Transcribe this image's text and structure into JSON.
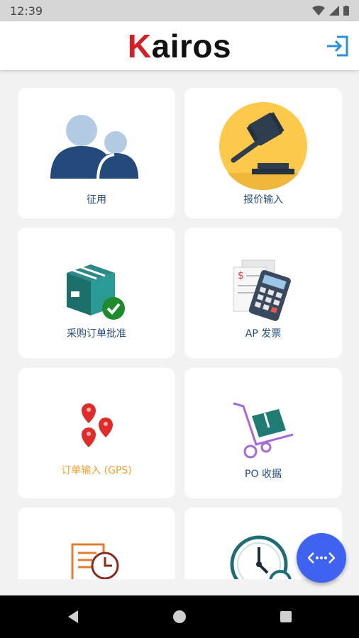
{
  "status": {
    "time": "12:39"
  },
  "header": {
    "logo_first": "K",
    "logo_rest": "airos"
  },
  "tiles": [
    {
      "label": "征用",
      "icon": "users-icon",
      "label_color": "#234a7a"
    },
    {
      "label": "报价输入",
      "icon": "gavel-icon",
      "label_color": "#234a7a"
    },
    {
      "label": "采购订单批准",
      "icon": "package-check-icon",
      "label_color": "#1b6e6a"
    },
    {
      "label": "AP 发票",
      "icon": "invoice-calculator-icon",
      "label_color": "#234a7a"
    },
    {
      "label": "订单输入 (GPS)",
      "icon": "map-pins-icon",
      "label_color": "#f0a030"
    },
    {
      "label": "PO 收据",
      "icon": "hand-truck-icon",
      "label_color": "#234a7a"
    },
    {
      "label": "",
      "icon": "document-clock-icon"
    },
    {
      "label": "",
      "icon": "clock-icon"
    }
  ],
  "colors": {
    "accent": "#3f63f0",
    "logo_red": "#d51f26"
  }
}
